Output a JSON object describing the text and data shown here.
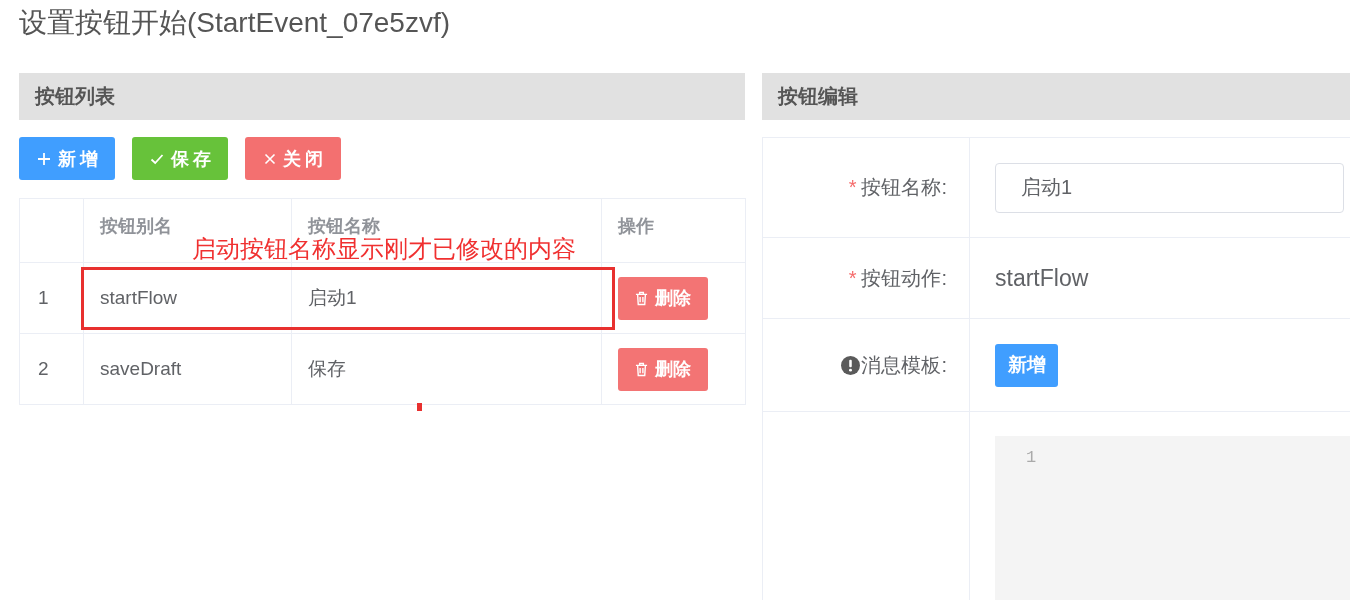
{
  "page": {
    "title": "设置按钮开始(StartEvent_07e5zvf)"
  },
  "button_list": {
    "header": "按钮列表",
    "toolbar": [
      {
        "kind": "add",
        "label": "新增"
      },
      {
        "kind": "save",
        "label": "保存"
      },
      {
        "kind": "close",
        "label": "关闭"
      }
    ],
    "table": {
      "columns": [
        "按钮别名",
        "按钮名称",
        "操作"
      ],
      "rows": [
        {
          "index": "1",
          "alias": "startFlow",
          "name": "启动1",
          "action": "删除",
          "highlighted": true
        },
        {
          "index": "2",
          "alias": "saveDraft",
          "name": "保存",
          "action": "删除",
          "highlighted": false
        }
      ]
    },
    "annotation": {
      "text": "启动按钮名称显示刚才已修改的内容"
    }
  },
  "button_editor": {
    "header": "按钮编辑",
    "fields": [
      {
        "kind": "input",
        "required_mark": "*",
        "label": "按钮名称:",
        "value": "启动1"
      },
      {
        "kind": "text",
        "required_mark": "*",
        "label": "按钮动作:",
        "value": "startFlow"
      },
      {
        "kind": "button",
        "info": true,
        "label": "消息模板:",
        "button": "新增"
      },
      {
        "kind": "code",
        "line_numbers": [
          "1"
        ]
      }
    ]
  }
}
